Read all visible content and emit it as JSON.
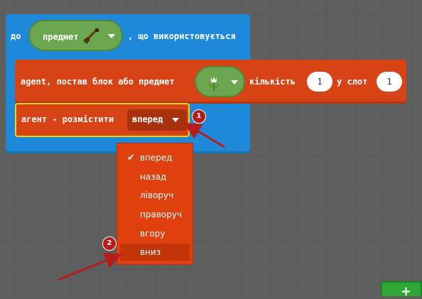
{
  "event_block": {
    "prefix": "до",
    "item_dropdown_label": "предмет",
    "suffix": ", що використовується"
  },
  "agent_place_block": {
    "label": "agent, постав блок або предмет",
    "count_label": "кількість",
    "count_value": "1",
    "slot_label": "у слот",
    "slot_value": "1"
  },
  "agent_move_block": {
    "label": "агент - розмістити",
    "direction_value": "вперед"
  },
  "direction_menu": {
    "items": [
      {
        "label": "вперед",
        "checked": true
      },
      {
        "label": "назад"
      },
      {
        "label": "ліворуч"
      },
      {
        "label": "праворуч"
      },
      {
        "label": "вгору"
      },
      {
        "label": "вниз",
        "highlighted": true
      }
    ]
  },
  "annotations": {
    "badge_1": "1",
    "badge_2": "2"
  },
  "add_button": {
    "icon": "+"
  },
  "colors": {
    "event_block": "#1e88d9",
    "agent_block": "#d84315",
    "item_dropdown": "#6da650",
    "selection_outline": "#f5d400",
    "annotation": "#b71c1c",
    "add_button": "#2fa836"
  }
}
